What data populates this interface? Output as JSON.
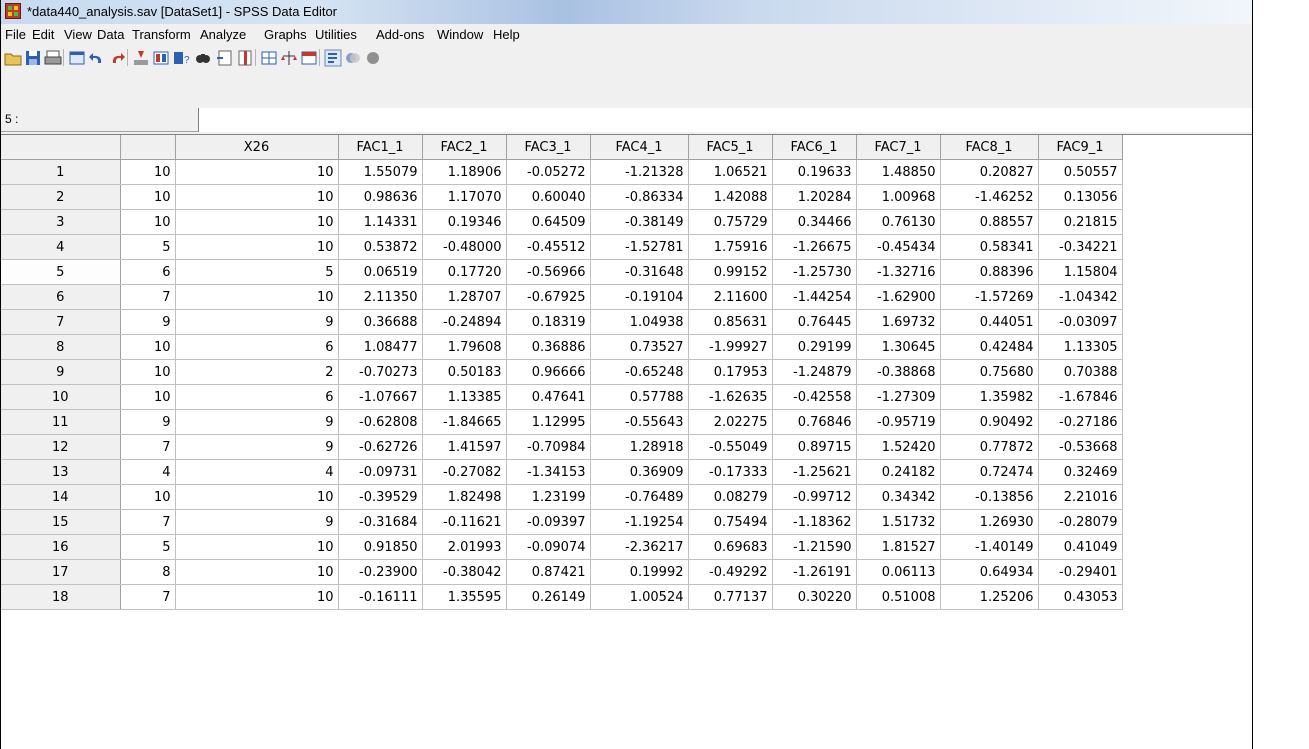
{
  "window": {
    "title": "*data440_analysis.sav [DataSet1] - SPSS Data Editor"
  },
  "menu": [
    "File",
    "Edit",
    "View",
    "Data",
    "Transform",
    "Analyze",
    "Graphs",
    "Utilities",
    "Add-ons",
    "Window",
    "Help"
  ],
  "toolbar": {
    "icons": [
      "open-file-icon",
      "save-icon",
      "print-icon",
      "dialog-recall-icon",
      "undo-icon",
      "redo-icon",
      "goto-case-icon",
      "variables-icon",
      "help-icon",
      "find-icon",
      "insert-cases-icon",
      "insert-variable-icon",
      "split-file-icon",
      "weight-cases-icon",
      "select-cases-icon",
      "value-labels-icon",
      "use-sets-icon",
      "show-all-variables-icon"
    ]
  },
  "cell_editor": {
    "reference": "5 :",
    "value": ""
  },
  "grid": {
    "columns": [
      "",
      "X26",
      "FAC1_1",
      "FAC2_1",
      "FAC3_1",
      "FAC4_1",
      "FAC5_1",
      "FAC6_1",
      "FAC7_1",
      "FAC8_1",
      "FAC9_1"
    ],
    "rows": [
      {
        "id": "1",
        "cells": [
          "10",
          "10",
          "1.55079",
          "1.18906",
          "-0.05272",
          "-1.21328",
          "1.06521",
          "0.19633",
          "1.48850",
          "0.20827",
          "0.50557"
        ]
      },
      {
        "id": "2",
        "cells": [
          "10",
          "10",
          "0.98636",
          "1.17070",
          "0.60040",
          "-0.86334",
          "1.42088",
          "1.20284",
          "1.00968",
          "-1.46252",
          "0.13056"
        ]
      },
      {
        "id": "3",
        "cells": [
          "10",
          "10",
          "1.14331",
          "0.19346",
          "0.64509",
          "-0.38149",
          "0.75729",
          "0.34466",
          "0.76130",
          "0.88557",
          "0.21815"
        ]
      },
      {
        "id": "4",
        "cells": [
          "5",
          "10",
          "0.53872",
          "-0.48000",
          "-0.45512",
          "-1.52781",
          "1.75916",
          "-1.26675",
          "-0.45434",
          "0.58341",
          "-0.34221"
        ]
      },
      {
        "id": "5",
        "cells": [
          "6",
          "5",
          "0.06519",
          "0.17720",
          "-0.56966",
          "-0.31648",
          "0.99152",
          "-1.25730",
          "-1.32716",
          "0.88396",
          "1.15804"
        ]
      },
      {
        "id": "6",
        "cells": [
          "7",
          "10",
          "2.11350",
          "1.28707",
          "-0.67925",
          "-0.19104",
          "2.11600",
          "-1.44254",
          "-1.62900",
          "-1.57269",
          "-1.04342"
        ]
      },
      {
        "id": "7",
        "cells": [
          "9",
          "9",
          "0.36688",
          "-0.24894",
          "0.18319",
          "1.04938",
          "0.85631",
          "0.76445",
          "1.69732",
          "0.44051",
          "-0.03097"
        ]
      },
      {
        "id": "8",
        "cells": [
          "10",
          "6",
          "1.08477",
          "1.79608",
          "0.36886",
          "0.73527",
          "-1.99927",
          "0.29199",
          "1.30645",
          "0.42484",
          "1.13305"
        ]
      },
      {
        "id": "9",
        "cells": [
          "10",
          "2",
          "-0.70273",
          "0.50183",
          "0.96666",
          "-0.65248",
          "0.17953",
          "-1.24879",
          "-0.38868",
          "0.75680",
          "0.70388"
        ]
      },
      {
        "id": "10",
        "cells": [
          "10",
          "6",
          "-1.07667",
          "1.13385",
          "0.47641",
          "0.57788",
          "-1.62635",
          "-0.42558",
          "-1.27309",
          "1.35982",
          "-1.67846"
        ]
      },
      {
        "id": "11",
        "cells": [
          "9",
          "9",
          "-0.62808",
          "-1.84665",
          "1.12995",
          "-0.55643",
          "2.02275",
          "0.76846",
          "-0.95719",
          "0.90492",
          "-0.27186"
        ]
      },
      {
        "id": "12",
        "cells": [
          "7",
          "9",
          "-0.62726",
          "1.41597",
          "-0.70984",
          "1.28918",
          "-0.55049",
          "0.89715",
          "1.52420",
          "0.77872",
          "-0.53668"
        ]
      },
      {
        "id": "13",
        "cells": [
          "4",
          "4",
          "-0.09731",
          "-0.27082",
          "-1.34153",
          "0.36909",
          "-0.17333",
          "-1.25621",
          "0.24182",
          "0.72474",
          "0.32469"
        ]
      },
      {
        "id": "14",
        "cells": [
          "10",
          "10",
          "-0.39529",
          "1.82498",
          "1.23199",
          "-0.76489",
          "0.08279",
          "-0.99712",
          "0.34342",
          "-0.13856",
          "2.21016"
        ]
      },
      {
        "id": "15",
        "cells": [
          "7",
          "9",
          "-0.31684",
          "-0.11621",
          "-0.09397",
          "-1.19254",
          "0.75494",
          "-1.18362",
          "1.51732",
          "1.26930",
          "-0.28079"
        ]
      },
      {
        "id": "16",
        "cells": [
          "5",
          "10",
          "0.91850",
          "2.01993",
          "-0.09074",
          "-2.36217",
          "0.69683",
          "-1.21590",
          "1.81527",
          "-1.40149",
          "0.41049"
        ]
      },
      {
        "id": "17",
        "cells": [
          "8",
          "10",
          "-0.23900",
          "-0.38042",
          "0.87421",
          "0.19992",
          "-0.49292",
          "-1.26191",
          "0.06113",
          "0.64934",
          "-0.29401"
        ]
      },
      {
        "id": "18",
        "cells": [
          "7",
          "10",
          "-0.16111",
          "1.35595",
          "0.26149",
          "1.00524",
          "0.77137",
          "0.30220",
          "0.51008",
          "1.25206",
          "0.43053"
        ]
      }
    ],
    "active_row": "5"
  }
}
